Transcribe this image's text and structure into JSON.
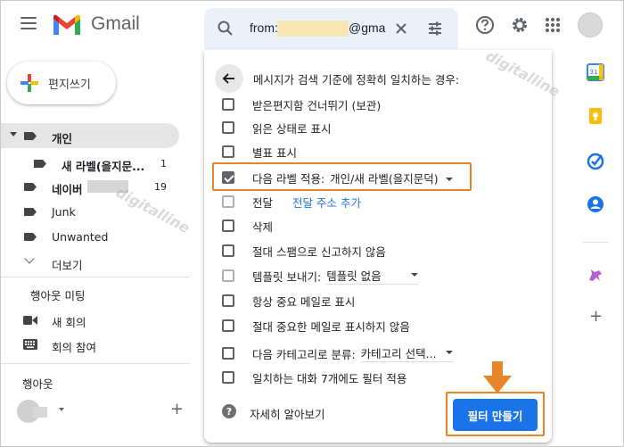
{
  "app": {
    "name": "Gmail"
  },
  "search": {
    "query_prefix": "from:",
    "query_suffix": "@gma"
  },
  "compose": {
    "label": "편지쓰기"
  },
  "nav": {
    "labels": [
      {
        "name": "개인",
        "selected": true
      },
      {
        "name": "새 라벨(을지문...",
        "count": "1"
      },
      {
        "name": "네이버",
        "count": "19"
      },
      {
        "name": "Junk"
      },
      {
        "name": "Unwanted"
      }
    ],
    "more": "더보기"
  },
  "meet": {
    "title": "행아웃 미팅",
    "new_meeting": "새 회의",
    "join_meeting": "회의 참여"
  },
  "hangouts": {
    "title": "행아웃"
  },
  "filter": {
    "header": "메시지가 검색 기준에 정확히 일치하는 경우:",
    "options": [
      {
        "label": "받은편지함 건너뛰기 (보관)"
      },
      {
        "label": "읽은 상태로 표시"
      },
      {
        "label": "별표 표시"
      },
      {
        "label": "다음 라벨 적용:",
        "value": "개인/새 라벨(을지문덕)",
        "checked": true
      },
      {
        "label": "전달",
        "link": "전달 주소 추가"
      },
      {
        "label": "삭제"
      },
      {
        "label": "절대 스팸으로 신고하지 않음"
      },
      {
        "label": "템플릿 보내기:",
        "value": "템플릿 없음"
      },
      {
        "label": "항상 중요 메일로 표시"
      },
      {
        "label": "절대 중요한 메일로 표시하지 않음"
      },
      {
        "label": "다음 카테고리로 분류:",
        "value": "카테고리 선택..."
      },
      {
        "label": "일치하는 대화 7개에도 필터 적용"
      }
    ],
    "learn_more": "자세히 알아보기",
    "create_button": "필터 만들기",
    "help_glyph": "?"
  },
  "side_panel": {
    "calendar_day": "31"
  },
  "watermark": "digitalline",
  "colors": {
    "accent_orange": "#ea8428",
    "primary_blue": "#1a73e8"
  }
}
